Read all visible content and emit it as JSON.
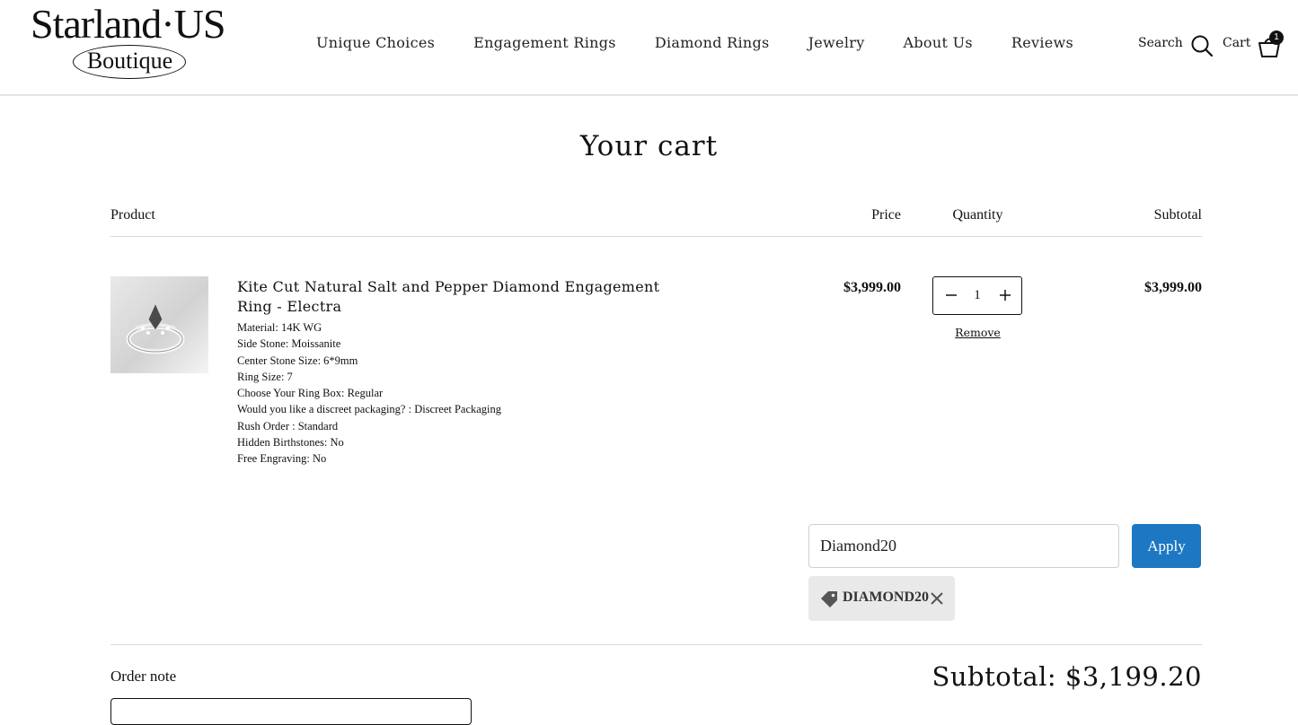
{
  "header": {
    "logo_top": "Starland·US",
    "logo_bottom": "Boutique",
    "nav": [
      "Unique Choices",
      "Engagement Rings",
      "Diamond Rings",
      "Jewelry",
      "About Us",
      "Reviews"
    ],
    "search_label": "Search",
    "cart_label": "Cart",
    "cart_count": "1"
  },
  "page": {
    "title": "Your cart"
  },
  "table": {
    "product": "Product",
    "price": "Price",
    "quantity": "Quantity",
    "subtotal": "Subtotal"
  },
  "item": {
    "title": "Kite Cut Natural Salt and Pepper Diamond Engagement Ring - Electra",
    "properties": [
      "Material: 14K WG",
      "Side Stone: Moissanite",
      "Center Stone Size: 6*9mm",
      "Ring Size: 7",
      "Choose Your Ring Box: Regular",
      "Would you like a discreet packaging? : Discreet Packaging",
      "Rush Order : Standard",
      "Hidden Birthstones: No",
      "Free Engraving: No"
    ],
    "price": "$3,999.00",
    "quantity": "1",
    "remove_label": "Remove",
    "subtotal": "$3,999.00"
  },
  "discount": {
    "input_value": "Diamond20",
    "apply_label": "Apply",
    "applied_code": "DIAMOND20"
  },
  "footer": {
    "order_note_label": "Order note",
    "subtotal_text": "Subtotal: $3,199.20"
  },
  "colors": {
    "accent": "#1d77c3",
    "tag_bg": "#e9e9e9",
    "rule": "#d9d9d9"
  }
}
